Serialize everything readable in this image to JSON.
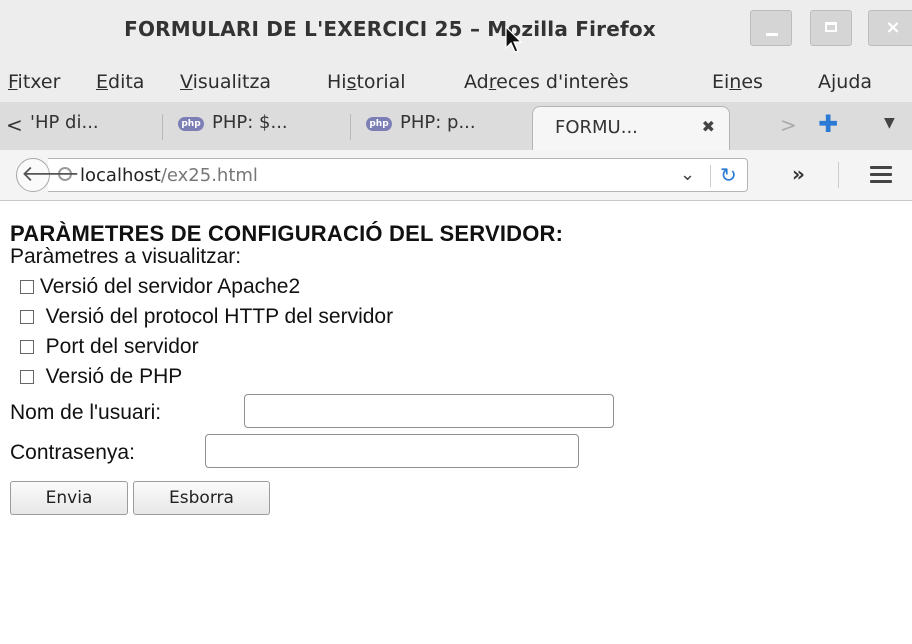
{
  "window": {
    "title": "FORMULARI DE L'EXERCICI 25 – Mozilla Firefox",
    "controls": [
      "minimize",
      "maximize",
      "close"
    ]
  },
  "menu": [
    {
      "label": "Fitxer",
      "accel": "F"
    },
    {
      "label": "Edita",
      "accel": "E"
    },
    {
      "label": "Visualitza",
      "accel": "V"
    },
    {
      "label": "Historial",
      "accel": "s"
    },
    {
      "label": "Adreces d'interès",
      "accel": "r"
    },
    {
      "label": "Eines",
      "accel": "n"
    },
    {
      "label": "Ajuda",
      "accel": "j"
    }
  ],
  "tabs": [
    {
      "label": "'HP di...",
      "icon": "php-favicon"
    },
    {
      "label": "PHP: $...",
      "icon": "php-favicon"
    },
    {
      "label": "PHP: p...",
      "icon": "php-favicon"
    },
    {
      "label": "FORMU...",
      "active": true
    }
  ],
  "tab_icons": {
    "php": "php"
  },
  "navbar": {
    "url_host": "localhost",
    "url_path": "/ex25.html"
  },
  "form": {
    "heading": "PARÀMETRES DE CONFIGURACIÓ DEL SERVIDOR:",
    "sublabel": "Paràmetres a visualitzar:",
    "checkboxes": [
      {
        "label": "Versió del servidor Apache2",
        "checked": false
      },
      {
        "label": "Versió del protocol HTTP del servidor",
        "checked": false
      },
      {
        "label": "Port del servidor",
        "checked": false
      },
      {
        "label": "Versió de PHP",
        "checked": false
      }
    ],
    "username_label": "Nom de l'usuari:",
    "username_value": "",
    "password_label": "Contrasenya:",
    "password_value": "",
    "submit_label": "Envia",
    "reset_label": "Esborra"
  },
  "colors": {
    "accent": "#2a7ad5",
    "chrome_bg": "#ededed"
  }
}
